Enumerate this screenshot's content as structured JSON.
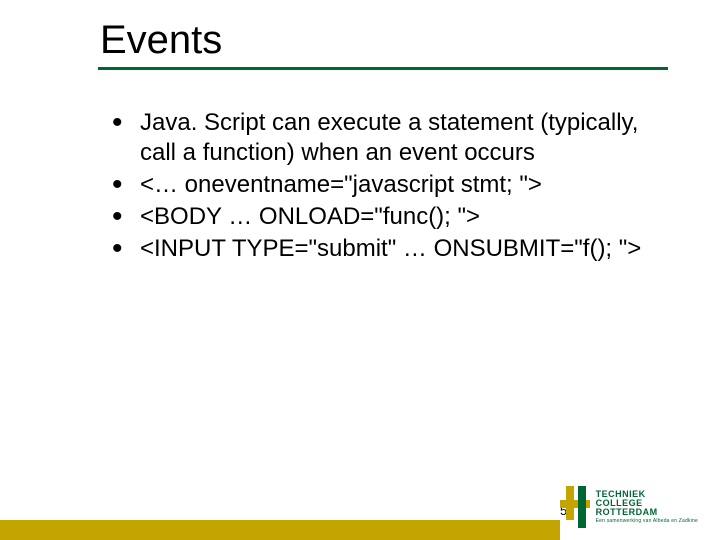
{
  "slide": {
    "title": "Events",
    "bullets": [
      "Java. Script can execute a statement (typically, call a function) when an event occurs",
      "<… oneventname=\"javascript stmt; \">",
      "<BODY … ONLOAD=\"func(); \">",
      "<INPUT TYPE=\"submit\" … ONSUBMIT=\"f(); \">"
    ],
    "page_number": "57"
  },
  "branding": {
    "line1": "TECHNIEK",
    "line2": "COLLEGE",
    "line3": "ROTTERDAM",
    "sub": "Een samenwerking van Albeda en Zadkine"
  },
  "colors": {
    "green": "#006633",
    "gold": "#c3a400"
  }
}
